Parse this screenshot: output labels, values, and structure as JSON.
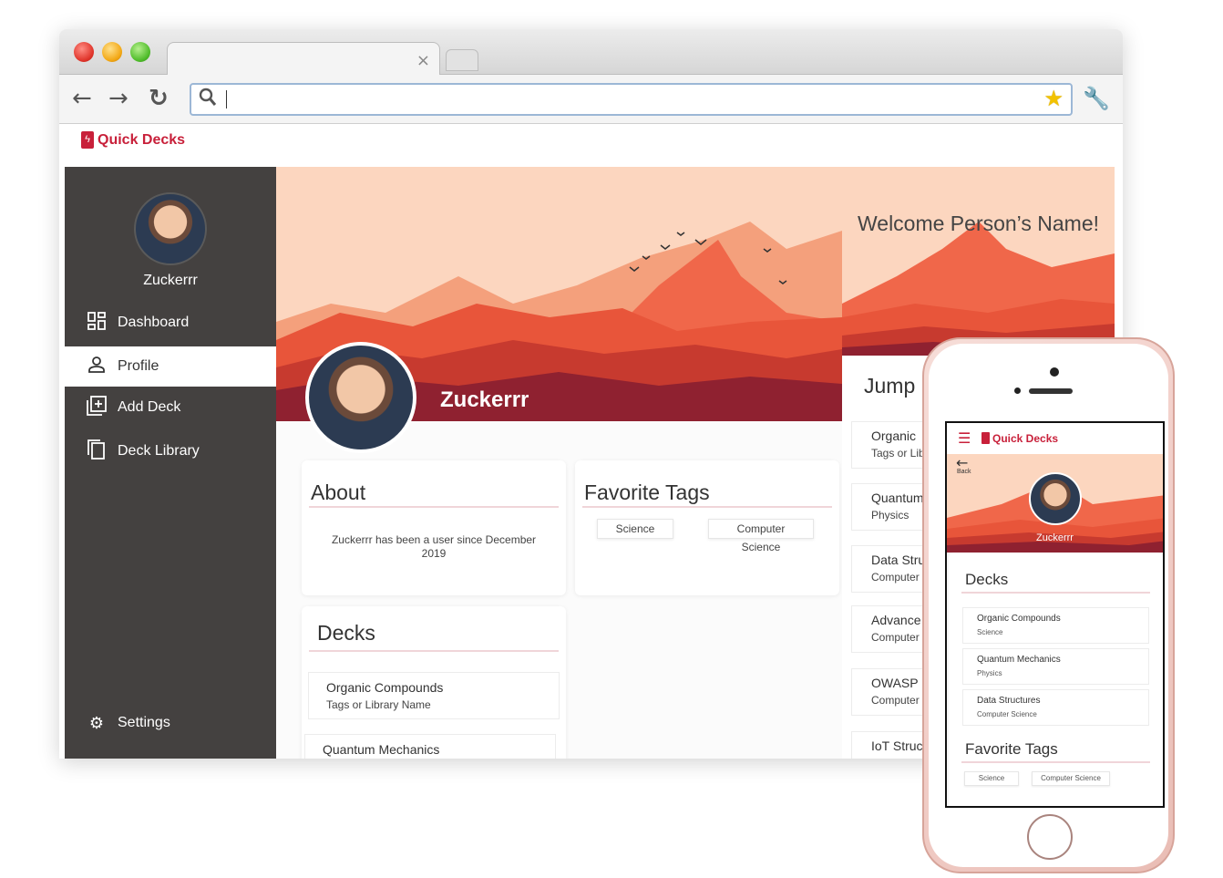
{
  "browser": {
    "address_value": "",
    "icons": [
      "back-arrow-icon",
      "forward-arrow-icon",
      "reload-icon",
      "search-icon",
      "star-icon",
      "wrench-icon"
    ]
  },
  "app": {
    "brand": "Quick Decks",
    "brand_color": "#c8203a",
    "sidebar": {
      "username": "Zuckerrr",
      "items": [
        {
          "label": "Dashboard",
          "icon": "dashboard-icon"
        },
        {
          "label": "Profile",
          "icon": "person-icon"
        },
        {
          "label": "Add Deck",
          "icon": "add-box-icon"
        },
        {
          "label": "Deck Library",
          "icon": "library-icon"
        }
      ],
      "settings": "Settings",
      "active_item": "Profile"
    },
    "profile": {
      "name": "Zuckerrr",
      "about": {
        "title": "About",
        "text": "Zuckerrr has been a user since December 2019"
      },
      "favorite_tags": {
        "title": "Favorite Tags",
        "tags": [
          "Science",
          "Computer Science"
        ]
      },
      "decks": {
        "title": "Decks",
        "items": [
          {
            "title": "Organic Compounds",
            "subtitle": "Tags or Library Name"
          },
          {
            "title": "Quantum Mechanics",
            "subtitle": ""
          }
        ]
      }
    },
    "right_panel": {
      "welcome": "Welcome Person’s Name!",
      "jump_title": "Jump",
      "items": [
        {
          "title": "Organic",
          "subtitle": "Tags or Lib"
        },
        {
          "title": "Quantum",
          "subtitle": "Physics"
        },
        {
          "title": "Data Stru",
          "subtitle": "Computer"
        },
        {
          "title": "Advance",
          "subtitle": "Computer"
        },
        {
          "title": "OWASP",
          "subtitle": "Computer"
        },
        {
          "title": "IoT Struc",
          "subtitle": ""
        }
      ]
    }
  },
  "mobile": {
    "brand": "Quick Decks",
    "back_label": "Back",
    "name": "Zuckerrr",
    "decks_title": "Decks",
    "decks": [
      {
        "title": "Organic Compounds",
        "subtitle": "Science"
      },
      {
        "title": "Quantum Mechanics",
        "subtitle": "Physics"
      },
      {
        "title": "Data Structures",
        "subtitle": "Computer Science"
      }
    ],
    "favorite_tags_title": "Favorite Tags",
    "tags": [
      "Science",
      "Computer Science"
    ]
  }
}
